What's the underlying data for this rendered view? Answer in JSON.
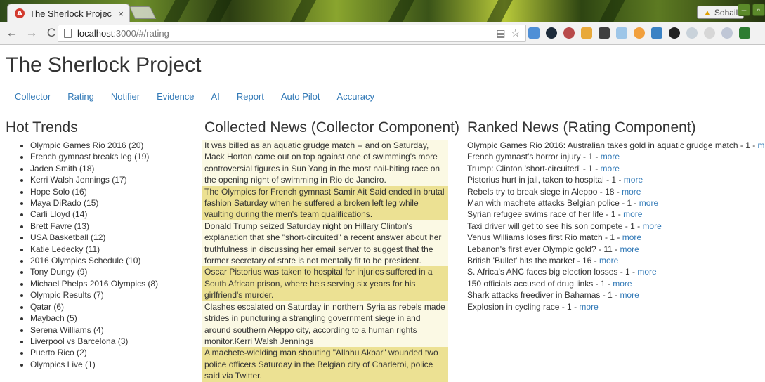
{
  "browser": {
    "tab_title": "The Sherlock Projec",
    "tab_close": "×",
    "tab_favicon_letter": "A",
    "url_host": "localhost",
    "url_path": ":3000/#/rating",
    "profile_name": "Sohail"
  },
  "app": {
    "title": "The Sherlock Project",
    "nav": [
      "Collector",
      "Rating",
      "Notifier",
      "Evidence",
      "AI",
      "Report",
      "Auto Pilot",
      "Accuracy"
    ]
  },
  "trends": {
    "heading": "Hot Trends",
    "items": [
      "Olympic Games Rio 2016 (20)",
      "French gymnast breaks leg (19)",
      "Jaden Smith (18)",
      "Kerri Walsh Jennings (17)",
      "Hope Solo (16)",
      "Maya DiRado (15)",
      "Carli Lloyd (14)",
      "Brett Favre (13)",
      "USA Basketball (12)",
      "Katie Ledecky (11)",
      "2016 Olympics Schedule (10)",
      "Tony Dungy (9)",
      "Michael Phelps 2016 Olympics (8)",
      "Olympic Results (7)",
      "Qatar (6)",
      "Maybach (5)",
      "Serena Williams (4)",
      "Liverpool vs Barcelona (3)",
      "Puerto Rico (2)",
      "Olympics Live (1)"
    ]
  },
  "collected": {
    "heading": "Collected News (Collector Component)",
    "items": [
      "It was billed as an aquatic grudge match -- and on Saturday, Mack Horton came out on top against one of swimming's more controversial figures in Sun Yang in the most nail-biting race on the opening night of swimming in Rio de Janeiro.",
      "The Olympics for French gymnast Samir Ait Said ended in brutal fashion Saturday when he suffered a broken left leg while vaulting during the men's team qualifications.",
      "Donald Trump seized Saturday night on Hillary Clinton's explanation that she \"short-circuited\" a recent answer about her truthfulness in discussing her email server to suggest that the former secretary of state is not mentally fit to be president.",
      "Oscar Pistorius was taken to hospital for injuries suffered in a South African prison, where he's serving six years for his girlfriend's murder.",
      "Clashes escalated on Saturday in northern Syria as rebels made strides in puncturing a strangling government siege in and around southern Aleppo city, according to a human rights monitor.Kerri Walsh Jennings",
      "A machete-wielding man shouting \"Allahu Akbar\" wounded two police officers Saturday in the Belgian city of Charleroi, police said via Twitter."
    ]
  },
  "ranked": {
    "heading": "Ranked News (Rating Component)",
    "more_label": "more",
    "items": [
      "Olympic Games Rio 2016: Australian takes gold in aquatic grudge match - 1 - ",
      "French gymnast's horror injury - 1 - ",
      "Trump: Clinton 'short-circuited' - 1 - ",
      "Pistorius hurt in jail, taken to hospital - 1 - ",
      "Rebels try to break siege in Aleppo - 18 - ",
      "Man with machete attacks Belgian police - 1 - ",
      "Syrian refugee swims race of her life - 1 - ",
      "Taxi driver will get to see his son compete - 1 - ",
      "Venus Williams loses first Rio match - 1 - ",
      "Lebanon's first ever Olympic gold? - 11 - ",
      "British 'Bullet' hits the market - 16 - ",
      "S. Africa's ANC faces big election losses - 1 - ",
      "150 officials accused of drug links - 1 - ",
      "Shark attacks freediver in Bahamas - 1 - ",
      "Explosion in cycling race - 1 - "
    ]
  },
  "colors": {
    "link": "#337ab7",
    "news_light": "#fbf9e4",
    "news_highlight": "#ece193"
  }
}
